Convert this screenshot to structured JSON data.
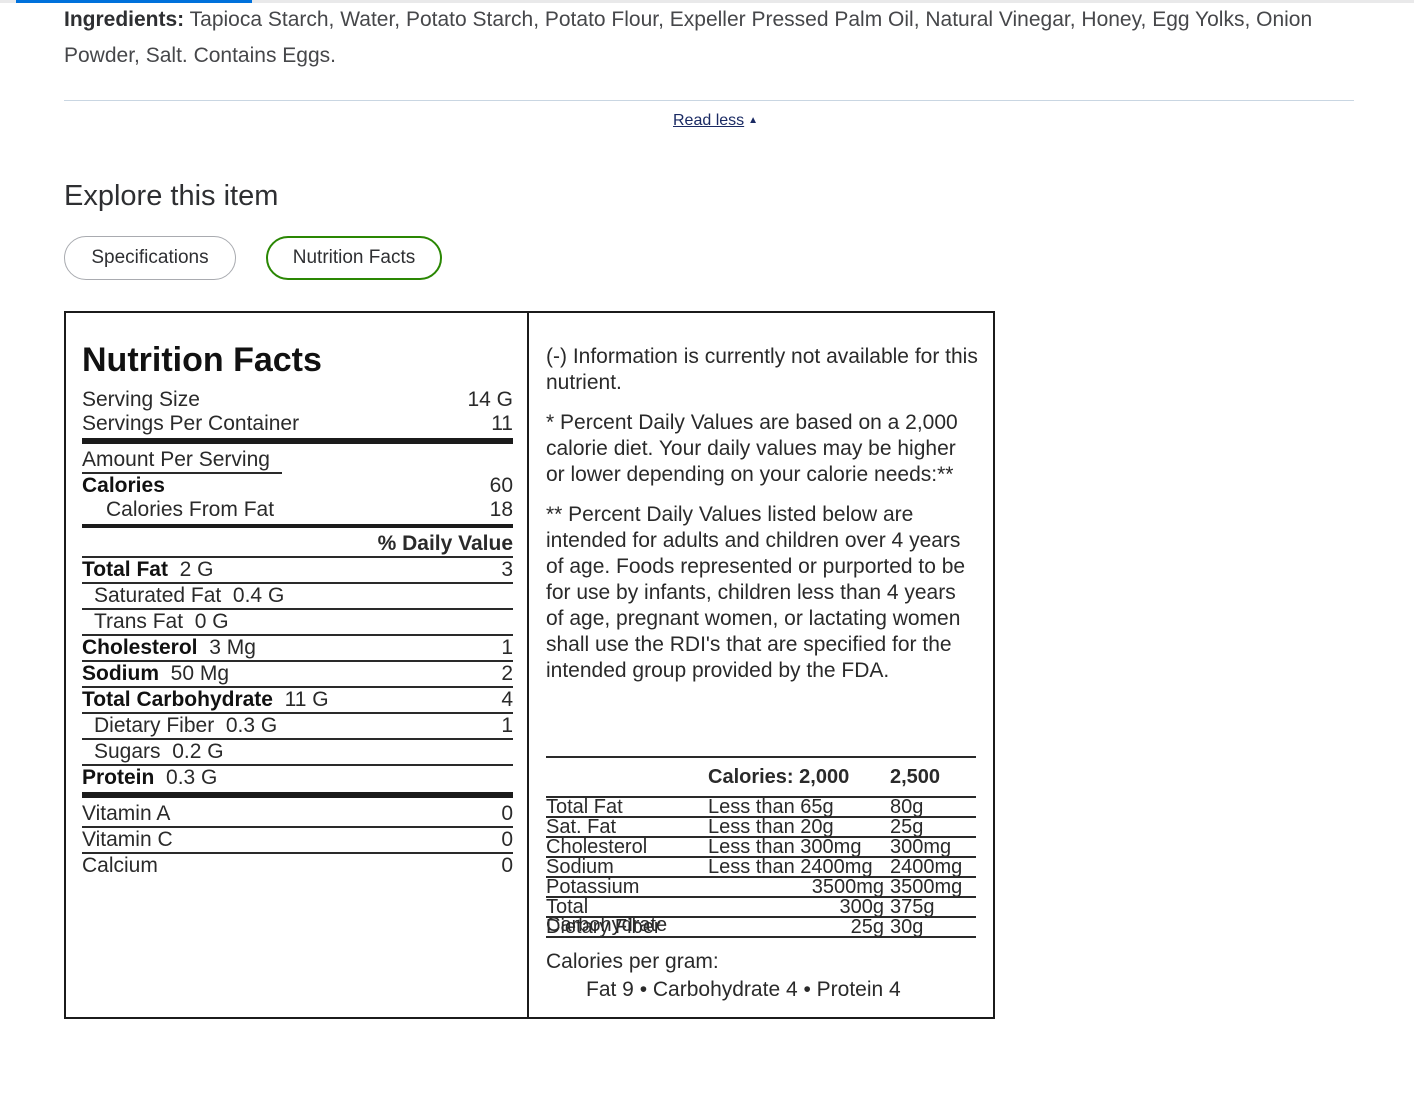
{
  "ingredients": {
    "label": "Ingredients:",
    "text": " Tapioca Starch, Water, Potato Starch, Potato Flour, Expeller Pressed Palm Oil, Natural Vinegar, Honey, Egg Yolks, Onion Powder, Salt. Contains Eggs."
  },
  "read_less": {
    "label": "Read less",
    "icon": "caret-up-icon"
  },
  "explore": {
    "title": "Explore this item",
    "tabs": [
      {
        "label": "Specifications",
        "selected": false
      },
      {
        "label": "Nutrition Facts",
        "selected": true
      }
    ]
  },
  "nutrition": {
    "title": "Nutrition Facts",
    "serving_size_label": "Serving Size",
    "serving_size": "14 G",
    "servings_label": "Servings Per Container",
    "servings": "11",
    "amount_per_serving": "Amount Per Serving",
    "calories_label": "Calories",
    "calories": "60",
    "calories_from_fat_label": "Calories From Fat",
    "calories_from_fat": "18",
    "daily_value_header": "% Daily Value",
    "nutrients": [
      {
        "name": "Total Fat",
        "amount": "2 G",
        "dv": "3"
      },
      {
        "name": "Saturated Fat",
        "amount": "0.4 G",
        "dv": ""
      },
      {
        "name": "Trans Fat",
        "amount": "0 G",
        "dv": ""
      },
      {
        "name": "Cholesterol",
        "amount": "3 Mg",
        "dv": "1"
      },
      {
        "name": "Sodium",
        "amount": "50 Mg",
        "dv": "2"
      },
      {
        "name": "Total Carbohydrate",
        "amount": "11 G",
        "dv": "4"
      },
      {
        "name": "Dietary Fiber",
        "amount": "0.3 G",
        "dv": "1"
      },
      {
        "name": "Sugars",
        "amount": "0.2 G",
        "dv": ""
      },
      {
        "name": "Protein",
        "amount": "0.3 G",
        "dv": ""
      }
    ],
    "vitamins": [
      {
        "name": "Vitamin A",
        "dv": "0"
      },
      {
        "name": "Vitamin C",
        "dv": "0"
      },
      {
        "name": "Calcium",
        "dv": "0"
      }
    ]
  },
  "notes": {
    "unavailable": "(-) Information is currently not available for this nutrient.",
    "pdv_note": "* Percent Daily Values are based on a 2,000 calorie diet. Your daily values may be higher or lower depending on your calorie needs:**",
    "pdv_adults": "** Percent Daily Values listed below are intended for adults and children over 4 years of age. Foods represented or purported to be for use by infants, children less than 4 years of age, pregnant women, or lactating women shall use the RDI's that are specified for the intended group provided by the FDA."
  },
  "dv_table": {
    "header_calories": "Calories: 2,000",
    "header_2500": "2,500",
    "rows": [
      {
        "name": "Total Fat",
        "limit": "Less than 65g",
        "high": "80g"
      },
      {
        "name": "Sat. Fat",
        "limit": "Less than 20g",
        "high": "25g"
      },
      {
        "name": "Cholesterol",
        "limit": "Less than 300mg",
        "high": "300mg"
      },
      {
        "name": "Sodium",
        "limit": "Less than 2400mg",
        "high": "2400mg"
      },
      {
        "name": "Potassium",
        "limit": "3500mg",
        "high": "3500mg"
      },
      {
        "name": "Total Carbohydrate",
        "limit": "300g",
        "high": "375g"
      },
      {
        "name": "Dietary Fiber",
        "limit": "25g",
        "high": "30g"
      }
    ]
  },
  "calories_per_gram": {
    "label": "Calories per gram:",
    "values": "Fat 9 • Carbohydrate 4 • Protein 4"
  },
  "colors": {
    "accent_blue": "#0071dc",
    "selected_tab_border": "#2a8703",
    "link": "#1a2a63"
  }
}
